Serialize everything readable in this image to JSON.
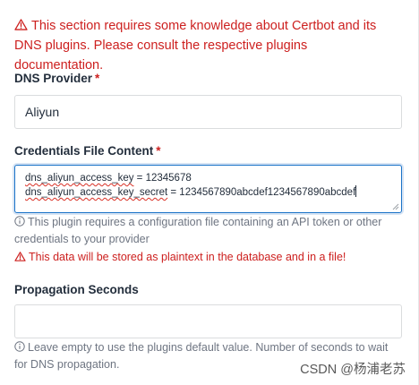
{
  "warning_banner": {
    "icon": "warning-triangle-icon",
    "text": "This section requires some knowledge about Certbot and its DNS plugins. Please consult the respective plugins documentation."
  },
  "dns_provider": {
    "label": "DNS Provider",
    "required_mark": "*",
    "value": "Aliyun"
  },
  "credentials": {
    "label": "Credentials File Content",
    "required_mark": "*",
    "line1_key": "dns_aliyun_access_key",
    "line1_rest": " = 12345678",
    "line2_key": "dns_aliyun_access_key_secret",
    "line2_rest": " = 1234567890abcdef1234567890abcdef",
    "hint": "This plugin requires a configuration file containing an API token or other credentials to your provider",
    "warning": "This data will be stored as plaintext in the database and in a file!"
  },
  "propagation": {
    "label": "Propagation Seconds",
    "value": "",
    "hint": "Leave empty to use the plugins default value. Number of seconds to wait for DNS propagation."
  },
  "watermark": "CSDN @杨浦老苏",
  "colors": {
    "danger": "#cd201f",
    "focus_border": "#1a73c8",
    "muted": "#6e7582"
  }
}
